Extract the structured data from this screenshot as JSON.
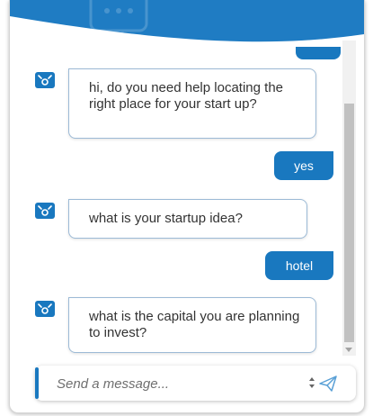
{
  "colors": {
    "accent": "#1978bf",
    "bot_bubble_border": "#9cbad6",
    "bot_text": "#333333",
    "user_text": "#ffffff"
  },
  "icons": {
    "header": "chat-bubble-icon",
    "bot": "bot-icon",
    "send": "send-icon"
  },
  "messages": [
    {
      "sender": "bot",
      "text": "hi, do you need help locating the right place for your start up?"
    },
    {
      "sender": "user",
      "text": "yes"
    },
    {
      "sender": "bot",
      "text": "what is your startup idea?"
    },
    {
      "sender": "user",
      "text": "hotel"
    },
    {
      "sender": "bot",
      "text": "what is the capital you are planning to invest?"
    }
  ],
  "composer": {
    "placeholder": "Send a message..."
  }
}
